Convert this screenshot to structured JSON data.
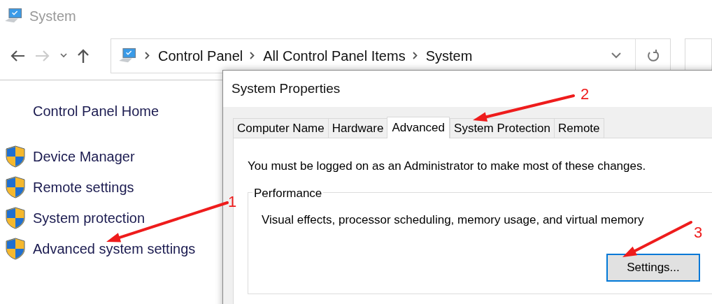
{
  "window": {
    "title": "System"
  },
  "navigation": {
    "forward_disabled": true
  },
  "address_bar": {
    "breadcrumbs": [
      "Control Panel",
      "All Control Panel Items",
      "System"
    ]
  },
  "sidebar": {
    "home_link": "Control Panel Home",
    "items": [
      "Device Manager",
      "Remote settings",
      "System protection",
      "Advanced system settings"
    ]
  },
  "dialog": {
    "title": "System Properties",
    "tabs": [
      {
        "label": "Computer Name",
        "selected": false
      },
      {
        "label": "Hardware",
        "selected": false
      },
      {
        "label": "Advanced",
        "selected": true
      },
      {
        "label": "System Protection",
        "selected": false
      },
      {
        "label": "Remote",
        "selected": false
      }
    ],
    "notice": "You must be logged on as an Administrator to make most of these changes.",
    "group": {
      "title": "Performance",
      "description": "Visual effects, processor scheduling, memory usage, and virtual memory",
      "button": "Settings..."
    }
  },
  "annotations": [
    {
      "label": "1"
    },
    {
      "label": "2"
    },
    {
      "label": "3"
    }
  ]
}
